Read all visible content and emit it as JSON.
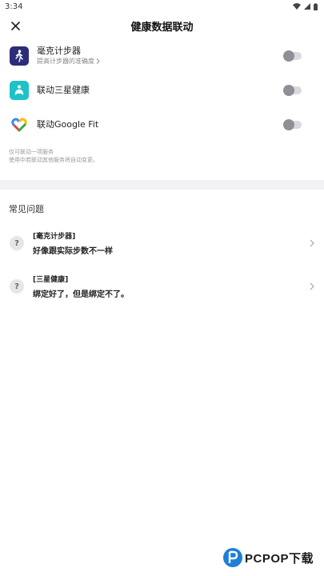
{
  "status_bar": {
    "time": "3:34"
  },
  "header": {
    "title": "健康数据联动"
  },
  "links": [
    {
      "name": "毫克计步器",
      "sub": "提高计步器的准确度",
      "icon": "walking-person-icon",
      "color": "#2b2d7a"
    },
    {
      "name": "联动三星健康",
      "sub": "",
      "icon": "samsung-health-icon",
      "color": "#1ec2c9"
    },
    {
      "name": "联动Google Fit",
      "sub": "",
      "icon": "google-fit-icon",
      "color": "#ffffff"
    }
  ],
  "note": {
    "line1": "仅可联动一项服务",
    "line2": "使用中若联动其他服务将自动变更。"
  },
  "faq": {
    "title": "常见问题",
    "items": [
      {
        "tag": "[毫克计步器]",
        "question": "好像跟实际步数不一样",
        "badge": "?"
      },
      {
        "tag": "[三星健康]",
        "question": "绑定好了，但是绑定不了。",
        "badge": "?"
      }
    ]
  },
  "watermark": {
    "text": "PCPOP下载"
  }
}
